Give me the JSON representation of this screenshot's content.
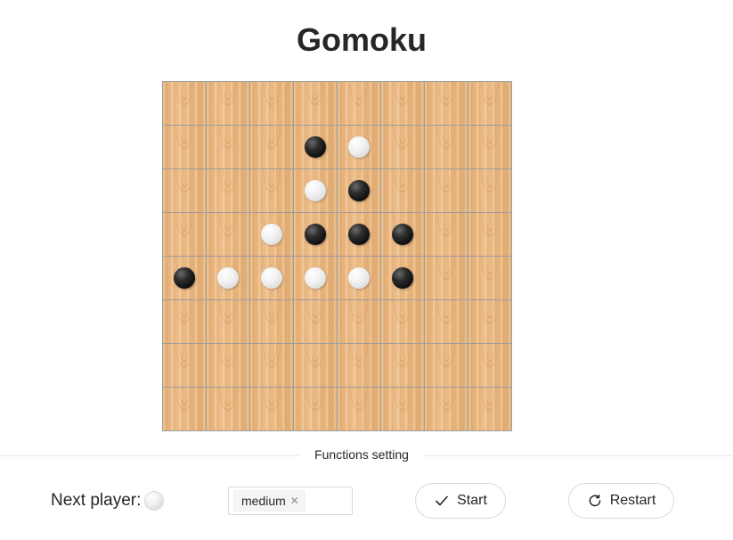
{
  "app": {
    "title": "Gomoku"
  },
  "board": {
    "size": 8,
    "rows": [
      [
        "",
        "",
        "",
        "",
        "",
        "",
        "",
        ""
      ],
      [
        "",
        "",
        "",
        "black",
        "white",
        "",
        "",
        ""
      ],
      [
        "",
        "",
        "",
        "white",
        "black",
        "",
        "",
        ""
      ],
      [
        "",
        "",
        "white",
        "black",
        "black",
        "black",
        "",
        ""
      ],
      [
        "black",
        "white",
        "white",
        "white",
        "white",
        "black",
        "",
        ""
      ],
      [
        "",
        "",
        "",
        "",
        "",
        "",
        "",
        ""
      ],
      [
        "",
        "",
        "",
        "",
        "",
        "",
        "",
        ""
      ],
      [
        "",
        "",
        "",
        "",
        "",
        "",
        "",
        ""
      ]
    ]
  },
  "functions": {
    "divider_label": "Functions setting",
    "next_player_label": "Next player:",
    "next_player": "white",
    "difficulty": {
      "selected": "medium",
      "remove_icon": "close-icon"
    },
    "start_button": {
      "label": "Start",
      "icon": "check-icon"
    },
    "restart_button": {
      "label": "Restart",
      "icon": "reload-icon"
    }
  }
}
